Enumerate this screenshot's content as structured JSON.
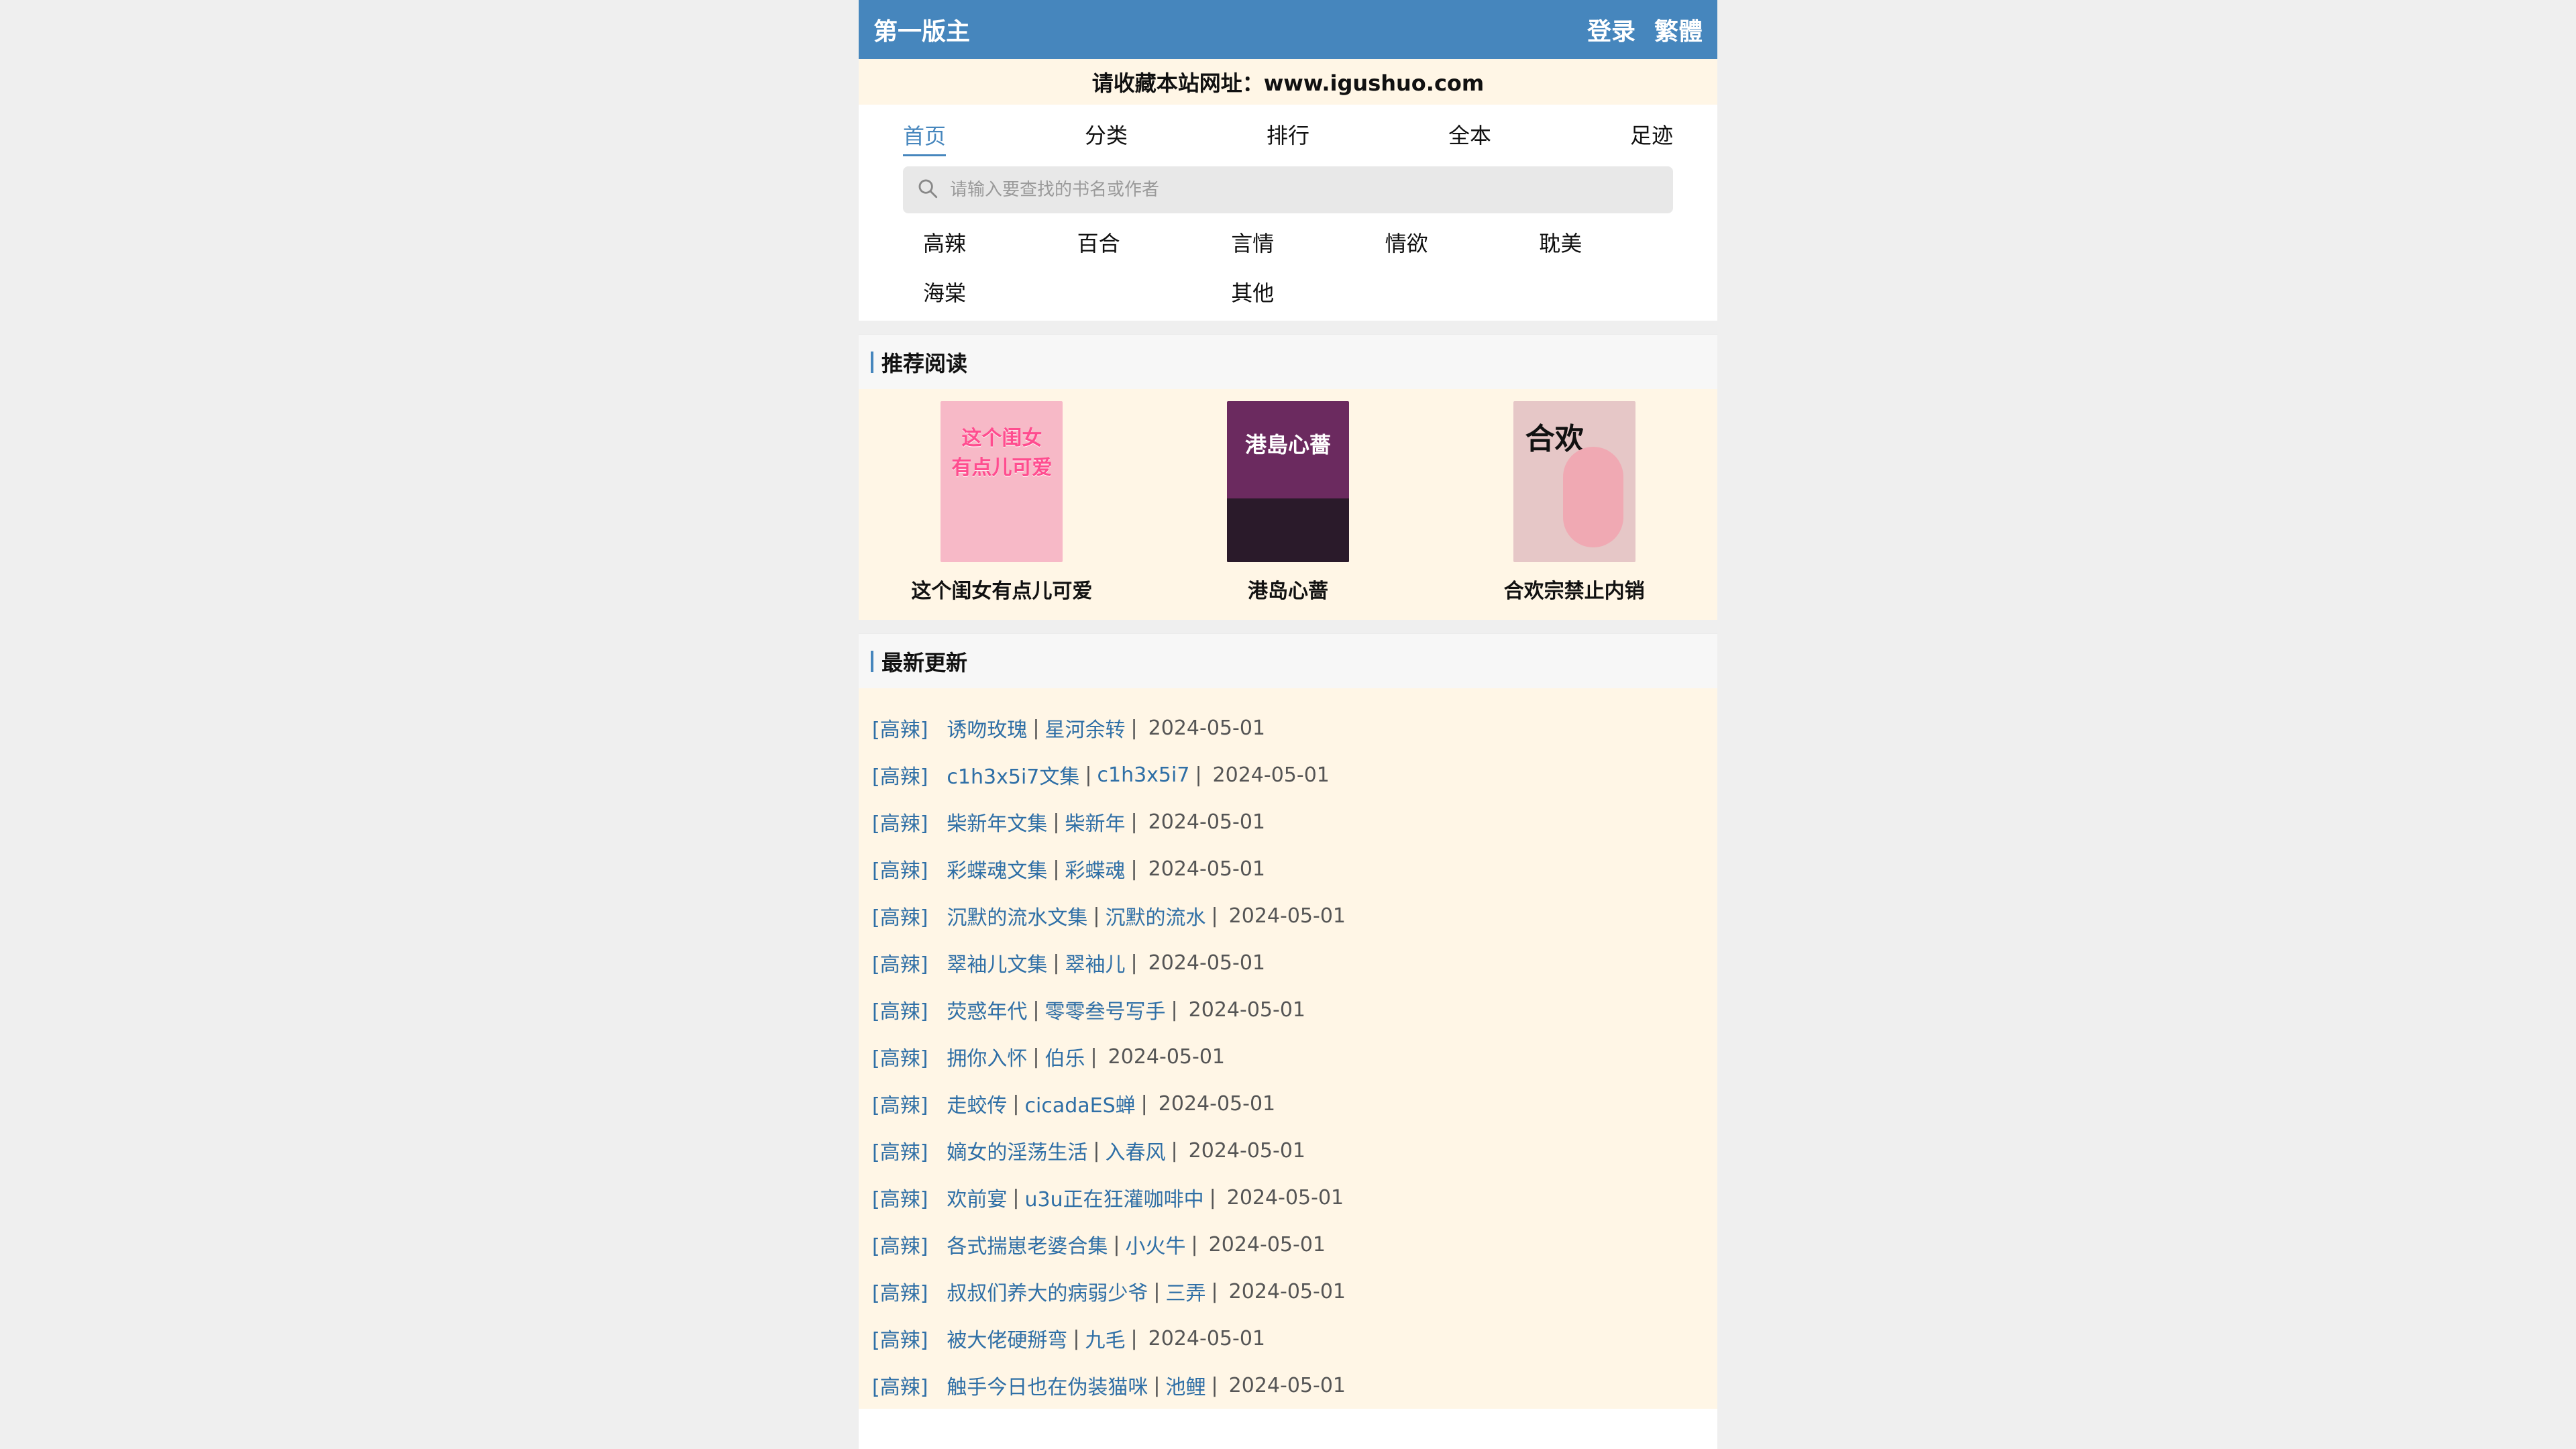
{
  "header": {
    "site_title": "第一版主",
    "login_label": "登录",
    "trad_label": "繁體"
  },
  "notice": {
    "text": "请收藏本站网址：www.igushuo.com"
  },
  "nav": {
    "items": [
      {
        "label": "首页",
        "active": true
      },
      {
        "label": "分类",
        "active": false
      },
      {
        "label": "排行",
        "active": false
      },
      {
        "label": "全本",
        "active": false
      },
      {
        "label": "足迹",
        "active": false
      }
    ]
  },
  "search": {
    "placeholder": "请输入要查找的书名或作者"
  },
  "categories": [
    "高辣",
    "百合",
    "言情",
    "情欲",
    "耽美",
    "海棠",
    "",
    "其他"
  ],
  "recommend": {
    "title": "推荐阅读",
    "books": [
      {
        "title": "这个闺女有点儿可爱",
        "cover_text": "这个闺女\n有点儿可爱",
        "cover_color": "#f7b9c7"
      },
      {
        "title": "港岛心蔷",
        "cover_text": "港島心薔",
        "cover_color": "#6b2a5f"
      },
      {
        "title": "合欢宗禁止内销",
        "cover_text": "合欢",
        "cover_color": "#e6c7c7"
      }
    ]
  },
  "latest": {
    "title": "最新更新",
    "rows": [
      {
        "category": "[高辣]",
        "title": "诱吻玫瑰",
        "author": "星河余转",
        "date": "2024-05-01"
      },
      {
        "category": "[高辣]",
        "title": "c1h3x5i7文集",
        "author": "c1h3x5i7",
        "date": "2024-05-01"
      },
      {
        "category": "[高辣]",
        "title": "柴新年文集",
        "author": "柴新年",
        "date": "2024-05-01"
      },
      {
        "category": "[高辣]",
        "title": "彩蝶魂文集",
        "author": "彩蝶魂",
        "date": "2024-05-01"
      },
      {
        "category": "[高辣]",
        "title": "沉默的流水文集",
        "author": "沉默的流水",
        "date": "2024-05-01"
      },
      {
        "category": "[高辣]",
        "title": "翠袖儿文集",
        "author": "翠袖儿",
        "date": "2024-05-01"
      },
      {
        "category": "[高辣]",
        "title": "荧惑年代",
        "author": "零零叁号写手",
        "date": "2024-05-01"
      },
      {
        "category": "[高辣]",
        "title": "拥你入怀",
        "author": "伯乐",
        "date": "2024-05-01"
      },
      {
        "category": "[高辣]",
        "title": "走蛟传",
        "author": "cicadaES蝉",
        "date": "2024-05-01"
      },
      {
        "category": "[高辣]",
        "title": "嫡女的淫荡生活",
        "author": "入春风",
        "date": "2024-05-01"
      },
      {
        "category": "[高辣]",
        "title": "欢前宴",
        "author": "u3u正在狂灌咖啡中",
        "date": "2024-05-01"
      },
      {
        "category": "[高辣]",
        "title": "各式揣崽老婆合集",
        "author": "小火牛",
        "date": "2024-05-01"
      },
      {
        "category": "[高辣]",
        "title": "叔叔们养大的病弱少爷",
        "author": "三弄",
        "date": "2024-05-01"
      },
      {
        "category": "[高辣]",
        "title": "被大佬硬掰弯",
        "author": "九毛",
        "date": "2024-05-01"
      },
      {
        "category": "[高辣]",
        "title": "触手今日也在伪装猫咪",
        "author": "池鲤",
        "date": "2024-05-01"
      }
    ]
  },
  "colors": {
    "header_bg": "#4686bd",
    "cream_bg": "#fff6e6",
    "link": "#2f6fa6"
  },
  "icons": {
    "search": "search-icon"
  }
}
